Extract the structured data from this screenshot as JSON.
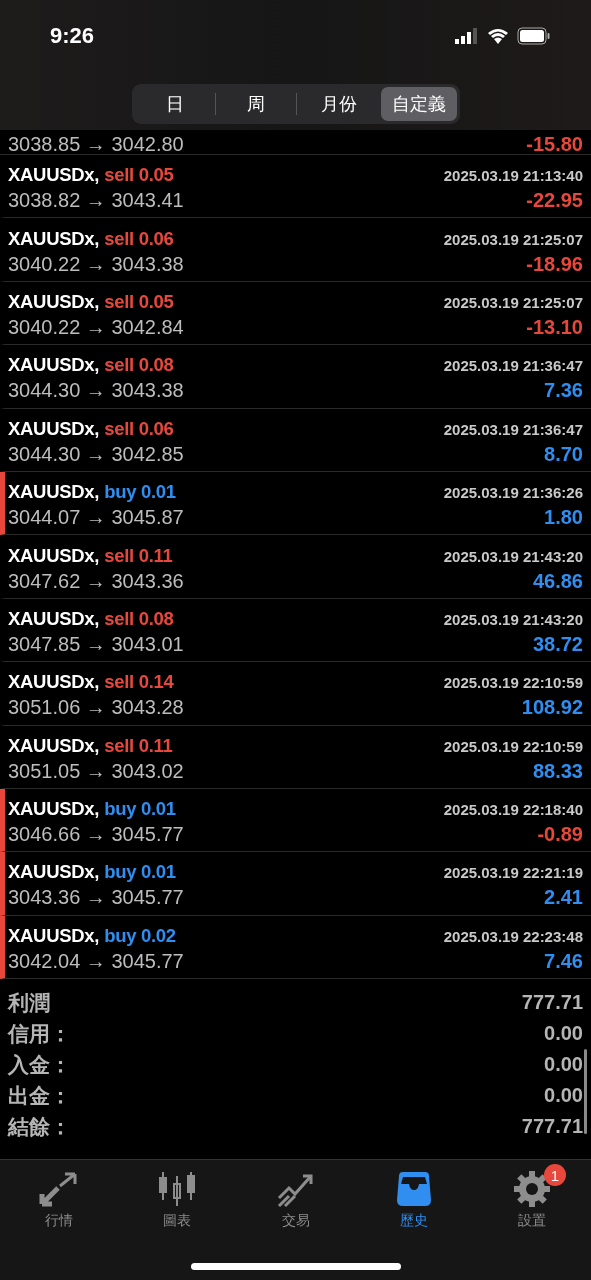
{
  "status_bar": {
    "time": "9:26"
  },
  "period_tabs": [
    {
      "label": "日",
      "selected": false
    },
    {
      "label": "周",
      "selected": false
    },
    {
      "label": "月份",
      "selected": false
    },
    {
      "label": "自定義",
      "selected": true
    }
  ],
  "partial_deal": {
    "prices": "3038.85 → 3042.80",
    "profit": "-15.80",
    "loss": true
  },
  "deals": [
    {
      "symbol": "XAUUSDx,",
      "buy": false,
      "order": "sell 0.05",
      "time": "2025.03.19 21:13:40",
      "prices": "3038.82 → 3043.41",
      "profit": "-22.95",
      "loss": true
    },
    {
      "symbol": "XAUUSDx,",
      "buy": false,
      "order": "sell 0.06",
      "time": "2025.03.19 21:25:07",
      "prices": "3040.22 → 3043.38",
      "profit": "-18.96",
      "loss": true
    },
    {
      "symbol": "XAUUSDx,",
      "buy": false,
      "order": "sell 0.05",
      "time": "2025.03.19 21:25:07",
      "prices": "3040.22 → 3042.84",
      "profit": "-13.10",
      "loss": true
    },
    {
      "symbol": "XAUUSDx,",
      "buy": false,
      "order": "sell 0.08",
      "time": "2025.03.19 21:36:47",
      "prices": "3044.30 → 3043.38",
      "profit": "7.36",
      "loss": false
    },
    {
      "symbol": "XAUUSDx,",
      "buy": false,
      "order": "sell 0.06",
      "time": "2025.03.19 21:36:47",
      "prices": "3044.30 → 3042.85",
      "profit": "8.70",
      "loss": false
    },
    {
      "symbol": "XAUUSDx,",
      "buy": true,
      "order": "buy 0.01",
      "time": "2025.03.19 21:36:26",
      "prices": "3044.07 → 3045.87",
      "profit": "1.80",
      "loss": false
    },
    {
      "symbol": "XAUUSDx,",
      "buy": false,
      "order": "sell 0.11",
      "time": "2025.03.19 21:43:20",
      "prices": "3047.62 → 3043.36",
      "profit": "46.86",
      "loss": false
    },
    {
      "symbol": "XAUUSDx,",
      "buy": false,
      "order": "sell 0.08",
      "time": "2025.03.19 21:43:20",
      "prices": "3047.85 → 3043.01",
      "profit": "38.72",
      "loss": false
    },
    {
      "symbol": "XAUUSDx,",
      "buy": false,
      "order": "sell 0.14",
      "time": "2025.03.19 22:10:59",
      "prices": "3051.06 → 3043.28",
      "profit": "108.92",
      "loss": false
    },
    {
      "symbol": "XAUUSDx,",
      "buy": false,
      "order": "sell 0.11",
      "time": "2025.03.19 22:10:59",
      "prices": "3051.05 → 3043.02",
      "profit": "88.33",
      "loss": false
    },
    {
      "symbol": "XAUUSDx,",
      "buy": true,
      "order": "buy 0.01",
      "time": "2025.03.19 22:18:40",
      "prices": "3046.66 → 3045.77",
      "profit": "-0.89",
      "loss": true
    },
    {
      "symbol": "XAUUSDx,",
      "buy": true,
      "order": "buy 0.01",
      "time": "2025.03.19 22:21:19",
      "prices": "3043.36 → 3045.77",
      "profit": "2.41",
      "loss": false
    },
    {
      "symbol": "XAUUSDx,",
      "buy": true,
      "order": "buy 0.02",
      "time": "2025.03.19 22:23:48",
      "prices": "3042.04 → 3045.77",
      "profit": "7.46",
      "loss": false
    }
  ],
  "summary": [
    {
      "label": "利潤",
      "value": "777.71"
    },
    {
      "label": "信用：",
      "value": "0.00"
    },
    {
      "label": "入金：",
      "value": "0.00"
    },
    {
      "label": "出金：",
      "value": "0.00"
    },
    {
      "label": "結餘：",
      "value": "777.71"
    }
  ],
  "tab_bar": [
    {
      "kind": "quotes",
      "label": "行情",
      "selected": false
    },
    {
      "kind": "chart",
      "label": "圖表",
      "selected": false
    },
    {
      "kind": "trade",
      "label": "交易",
      "selected": false
    },
    {
      "kind": "history",
      "label": "歷史",
      "selected": true
    },
    {
      "kind": "settings",
      "label": "設置",
      "selected": false,
      "badge": "1"
    }
  ]
}
